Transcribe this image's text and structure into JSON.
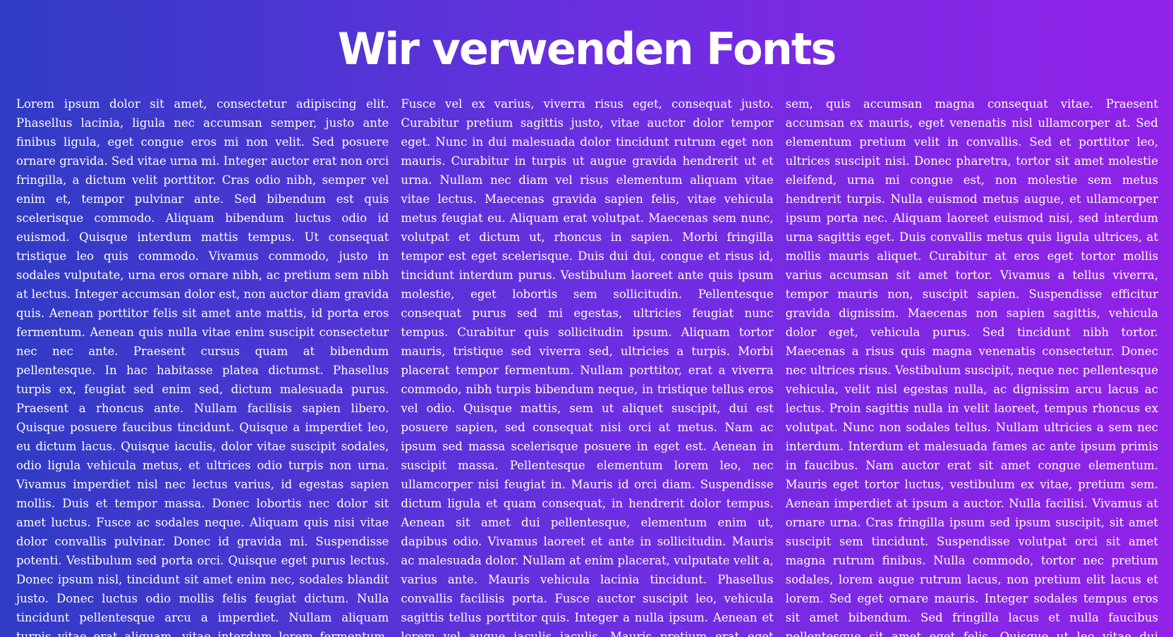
{
  "page": {
    "title": "Wir verwenden Fonts"
  },
  "colors": {
    "gradient_start": "#2f3cc4",
    "gradient_end": "#9222e8",
    "text": "#ffffff"
  },
  "columns": [
    "Lorem ipsum dolor sit amet, consectetur adipiscing elit. Phasellus lacinia, ligula nec accumsan semper, justo ante finibus ligula, eget congue eros mi non velit. Sed posuere ornare gravida. Sed vitae urna mi. Integer auctor erat non orci fringilla, a dictum velit porttitor. Cras odio nibh, semper vel enim et, tempor pulvinar ante. Sed bibendum est quis scelerisque commodo. Aliquam bibendum luctus odio id euismod. Quisque interdum mattis tempus. Ut consequat tristique leo quis commodo. Vivamus commodo, justo in sodales vulputate, urna eros ornare nibh, ac pretium sem nibh at lectus. Integer accumsan dolor est, non auctor diam gravida quis. Aenean porttitor felis sit amet ante mattis, id porta eros fermentum. Aenean quis nulla vitae enim suscipit consectetur nec nec ante. Praesent cursus quam at bibendum pellentesque. In hac habitasse platea dictumst. Phasellus turpis ex, feugiat sed enim sed, dictum malesuada purus. Praesent a rhoncus ante. Nullam facilisis sapien libero. Quisque posuere faucibus tincidunt. Quisque a imperdiet leo, eu dictum lacus. Quisque iaculis, dolor vitae suscipit sodales, odio ligula vehicula metus, et ultrices odio turpis non urna. Vivamus imperdiet nisl nec lectus varius, id egestas sapien mollis. Duis et tempor massa. Donec lobortis nec dolor sit amet luctus. Fusce ac sodales neque. Aliquam quis nisi vitae dolor convallis pulvinar. Donec id gravida mi. Suspendisse potenti. Vestibulum sed porta orci. Quisque eget purus lectus. Donec ipsum nisl, tincidunt sit amet enim nec, sodales blandit justo. Donec luctus odio mollis felis feugiat dictum. Nulla tincidunt pellentesque arcu a imperdiet. Nullam aliquam turpis vitae erat aliquam, vitae interdum lorem fermentum. Proin finibus erat non velit porta",
    "Fusce vel ex varius, viverra risus eget, consequat justo. Curabitur pretium sagittis justo, vitae auctor dolor tempor eget. Nunc in dui malesuada dolor tincidunt rutrum eget non mauris. Curabitur in turpis ut augue gravida hendrerit ut et urna. Nullam nec diam vel risus elementum aliquam vitae vitae lectus. Maecenas gravida sapien felis, vitae vehicula metus feugiat eu. Aliquam erat volutpat. Maecenas sem nunc, volutpat et dictum ut, rhoncus in sapien. Morbi fringilla tempor est eget scelerisque. Duis dui dui, congue et risus id, tincidunt interdum purus. Vestibulum laoreet ante quis ipsum molestie, eget lobortis sem sollicitudin. Pellentesque consequat purus sed mi egestas, ultricies feugiat nunc tempus. Curabitur quis sollicitudin ipsum. Aliquam tortor mauris, tristique sed viverra sed, ultricies a turpis. Morbi placerat tempor fermentum. Nullam porttitor, erat a viverra commodo, nibh turpis bibendum neque, in tristique tellus eros vel odio. Quisque mattis, sem ut aliquet suscipit, dui est posuere sapien, sed consequat nisi orci at metus. Nam ac ipsum sed massa scelerisque posuere in eget est. Aenean in suscipit massa. Pellentesque elementum lorem leo, nec ullamcorper nisi feugiat in. Mauris id orci diam. Suspendisse dictum ligula et quam consequat, in hendrerit dolor tempus. Aenean sit amet dui pellentesque, elementum enim ut, dapibus odio. Vivamus laoreet et ante in sollicitudin. Mauris ac malesuada dolor. Nullam at enim placerat, vulputate velit a, varius ante. Mauris vehicula lacinia tincidunt. Phasellus convallis facilisis porta. Fusce auctor suscipit leo, vehicula sagittis tellus porttitor quis. Integer a nulla ipsum. Aenean et lorem vel augue iaculis iaculis. Mauris pretium erat eget hendrerit placerat tellus",
    "sem, quis accumsan magna consequat vitae. Praesent accumsan ex mauris, eget venenatis nisl ullamcorper at. Sed elementum pretium velit in convallis. Sed et porttitor leo, ultrices suscipit nisi. Donec pharetra, tortor sit amet molestie eleifend, urna mi congue est, non molestie sem metus hendrerit turpis. Nulla euismod metus augue, et ullamcorper ipsum porta nec. Aliquam laoreet euismod nisi, sed interdum urna sagittis eget. Duis convallis metus quis ligula ultrices, at mollis mauris aliquet. Curabitur at eros eget tortor mollis varius accumsan sit amet tortor. Vivamus a tellus viverra, tempor mauris non, suscipit sapien. Suspendisse efficitur gravida dignissim. Maecenas non sapien sagittis, vehicula dolor eget, vehicula purus. Sed tincidunt nibh tortor. Maecenas a risus quis magna venenatis consectetur. Donec nec ultrices risus. Vestibulum suscipit, neque nec pellentesque vehicula, velit nisl egestas nulla, ac dignissim arcu lacus ac lectus. Proin sagittis nulla in velit laoreet, tempus rhoncus ex volutpat. Nunc non sodales tellus. Nullam ultricies a sem nec interdum. Interdum et malesuada fames ac ante ipsum primis in faucibus. Nam auctor erat sit amet congue elementum. Mauris eget tortor luctus, vestibulum ex vitae, pretium sem. Aenean imperdiet at ipsum a auctor. Nulla facilisi. Vivamus at ornare urna. Cras fringilla ipsum sed ipsum suscipit, sit amet suscipit sem tincidunt. Suspendisse volutpat orci sit amet magna rutrum finibus. Nulla commodo, tortor nec pretium sodales, lorem augue rutrum lacus, non pretium elit lacus et lorem. Sed eget ornare mauris. Integer sodales tempus eros sit amet bibendum. Sed fringilla lacus et nulla faucibus pellentesque sit amet eget felis. Quisque ut leo vitae dui fringilla interdum. Lorem ipsum dolor sit amet"
  ]
}
